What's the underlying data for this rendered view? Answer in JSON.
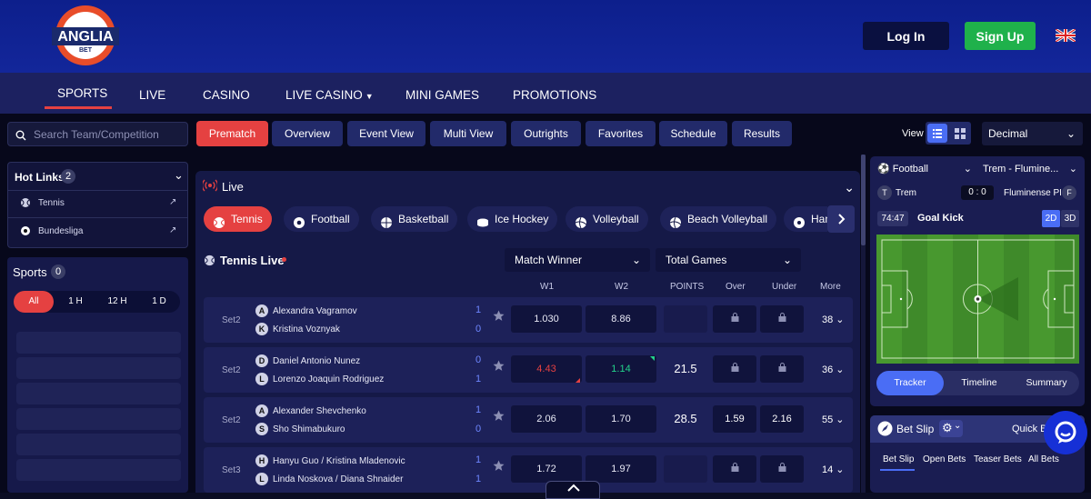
{
  "brand": {
    "logo_text": "ANGLIA",
    "logo_sub": "BET"
  },
  "header": {
    "login": "Log In",
    "signup": "Sign Up",
    "language_icon": "uk-flag-icon"
  },
  "nav": {
    "items": [
      "SPORTS",
      "LIVE",
      "CASINO",
      "LIVE CASINO",
      "MINI GAMES",
      "PROMOTIONS"
    ],
    "active": "SPORTS"
  },
  "search": {
    "placeholder": "Search Team/Competition"
  },
  "view_tabs": [
    "Prematch",
    "Overview",
    "Event View",
    "Multi View",
    "Outrights",
    "Favorites",
    "Schedule",
    "Results"
  ],
  "view": {
    "label": "View",
    "odds_format": "Decimal"
  },
  "hotlinks": {
    "title": "Hot Links",
    "count": "2",
    "items": [
      "Tennis",
      "Bundesliga"
    ]
  },
  "sports_panel": {
    "title": "Sports",
    "count": "0",
    "filters": [
      "All",
      "1 H",
      "12 H",
      "1 D"
    ]
  },
  "live": {
    "title": "Live",
    "sport_tabs": [
      "Tennis",
      "Football",
      "Basketball",
      "Ice Hockey",
      "Volleyball",
      "Beach Volleyball",
      "Hand"
    ],
    "section_title": "Tennis Live",
    "market_select": "Match Winner",
    "market_select_2": "Total Games",
    "columns": [
      "W1",
      "W2",
      "POINTS",
      "Over",
      "Under",
      "More"
    ],
    "matches": [
      {
        "set": "Set2",
        "l1": "A",
        "t1": "Alexandra Vagramov",
        "l2": "K",
        "t2": "Kristina Voznyak",
        "s1": "1",
        "s2": "0",
        "w1": "1.030",
        "w2": "8.86",
        "points": "",
        "over": "",
        "under": "",
        "more": "38"
      },
      {
        "set": "Set2",
        "l1": "D",
        "t1": "Daniel Antonio Nunez",
        "l2": "L",
        "t2": "Lorenzo Joaquin Rodriguez",
        "s1": "0",
        "s2": "1",
        "w1": "4.43",
        "w2": "1.14",
        "points": "21.5",
        "over": "",
        "under": "",
        "more": "36"
      },
      {
        "set": "Set2",
        "l1": "A",
        "t1": "Alexander Shevchenko",
        "l2": "S",
        "t2": "Sho Shimabukuro",
        "s1": "1",
        "s2": "0",
        "w1": "2.06",
        "w2": "1.70",
        "points": "28.5",
        "over": "1.59",
        "under": "2.16",
        "more": "55"
      },
      {
        "set": "Set3",
        "l1": "H",
        "t1": "Hanyu Guo / Kristina Mladenovic",
        "l2": "L",
        "t2": "Linda Noskova / Diana Shnaider",
        "s1": "1",
        "s2": "1",
        "w1": "1.72",
        "w2": "1.97",
        "points": "",
        "over": "",
        "under": "",
        "more": "14"
      }
    ]
  },
  "tracker": {
    "sport": "Football",
    "match": "Trem - Flumine...",
    "home_letter": "T",
    "home": "Trem",
    "away_letter": "F",
    "away": "Fluminense PI",
    "score_home": "0",
    "score_away": "0",
    "time": "74:47",
    "event": "Goal Kick",
    "mode_2d": "2D",
    "mode_3d": "3D",
    "tabs": [
      "Tracker",
      "Timeline",
      "Summary"
    ]
  },
  "betslip": {
    "title": "Bet Slip",
    "quick": "Quick Be",
    "tabs": [
      "Bet Slip",
      "Open Bets",
      "Teaser Bets",
      "All Bets"
    ]
  }
}
